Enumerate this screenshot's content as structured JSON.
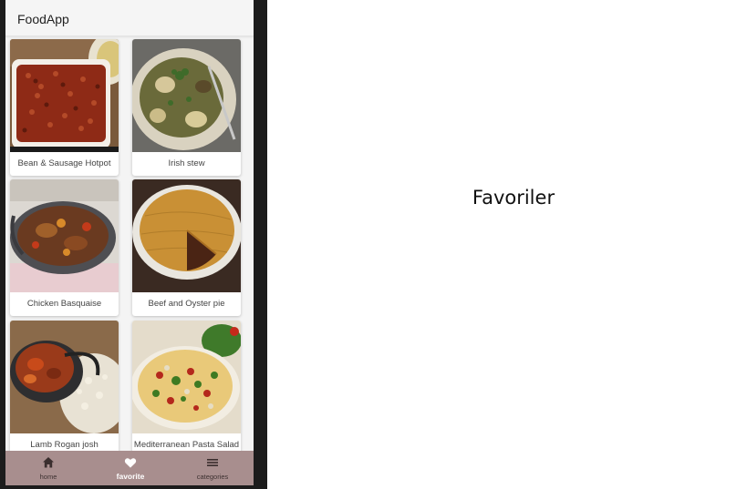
{
  "app": {
    "title": "FoodApp"
  },
  "recipes": [
    {
      "name": "Bean & Sausage Hotpot",
      "image": "bean-sausage-hotpot"
    },
    {
      "name": "Irish stew",
      "image": "irish-stew"
    },
    {
      "name": "Chicken Basquaise",
      "image": "chicken-basquaise"
    },
    {
      "name": "Beef and Oyster pie",
      "image": "beef-oyster-pie"
    },
    {
      "name": "Lamb Rogan josh",
      "image": "lamb-rogan-josh"
    },
    {
      "name": "Mediterranean Pasta Salad",
      "image": "mediterranean-pasta-salad"
    }
  ],
  "bottom_nav": {
    "items": [
      {
        "label": "home",
        "icon": "home-icon",
        "active": false
      },
      {
        "label": "favorite",
        "icon": "heart-icon",
        "active": true
      },
      {
        "label": "categories",
        "icon": "menu-icon",
        "active": false
      }
    ],
    "background": "#a88e8e"
  },
  "content": {
    "heading": "Favoriler"
  }
}
